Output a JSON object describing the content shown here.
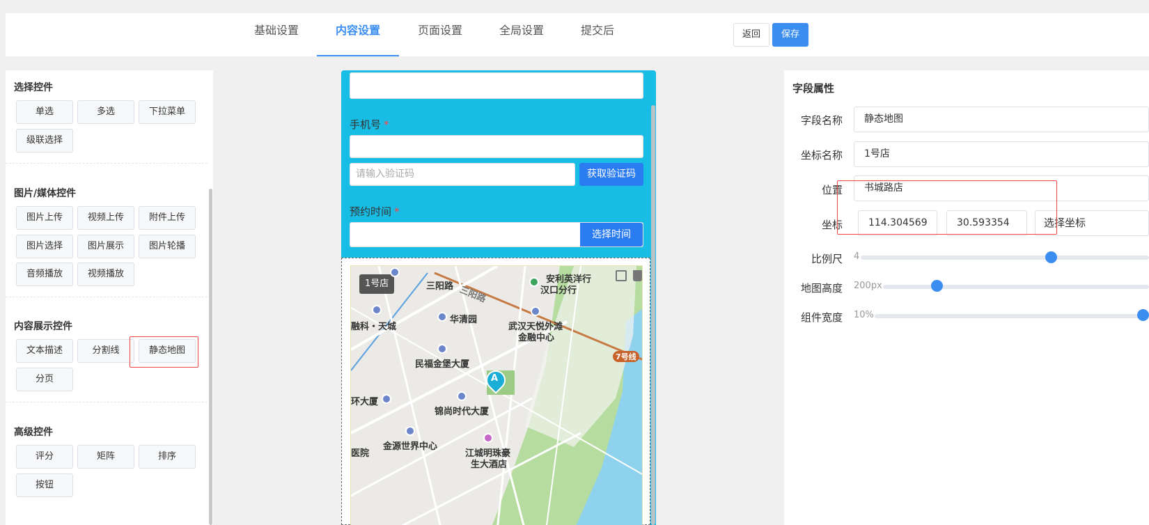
{
  "tabs": [
    "基础设置",
    "内容设置",
    "页面设置",
    "全局设置",
    "提交后"
  ],
  "active_tab": "内容设置",
  "actions": {
    "back": "返回",
    "save": "保存"
  },
  "left": {
    "groups": [
      {
        "title": "选择控件",
        "items": [
          "单选",
          "多选",
          "下拉菜单",
          "级联选择"
        ]
      },
      {
        "title": "图片/媒体控件",
        "items": [
          "图片上传",
          "视频上传",
          "附件上传",
          "图片选择",
          "图片展示",
          "图片轮播",
          "音频播放",
          "视频播放"
        ]
      },
      {
        "title": "内容展示控件",
        "items": [
          "文本描述",
          "分割线",
          "静态地图",
          "分页"
        ]
      },
      {
        "title": "高级控件",
        "items": [
          "评分",
          "矩阵",
          "排序",
          "按钮"
        ]
      }
    ]
  },
  "form": {
    "phone_label": "手机号",
    "required_mark": "*",
    "code_placeholder": "请输入验证码",
    "get_code": "获取验证码",
    "time_label": "预约时间",
    "pick_time": "选择时间"
  },
  "map": {
    "tag": "1号店",
    "labels": [
      "三阳路",
      "三阳路",
      "安利英洋行",
      "汉口分行",
      "融科・天城",
      "华清园",
      "武汉天悦外滩",
      "金融中心",
      "民福金堡大厦",
      "7号线",
      "环大厦",
      "锦尚时代大厦",
      "金源世界中心",
      "江城明珠豪",
      "生大酒店",
      "医院"
    ],
    "marker": "A"
  },
  "props": {
    "title": "字段属性",
    "field_name_label": "字段名称",
    "field_name": "静态地图",
    "coord_name_label": "坐标名称",
    "coord_name": "1号店",
    "location_label": "位置",
    "location": "书城路店",
    "coord_label": "坐标",
    "lng": "114.304569",
    "lat": "30.593354",
    "pick_coord": "选择坐标",
    "scale_label": "比例尺",
    "scale_value": "4",
    "height_label": "地图高度",
    "height_value": "200px",
    "width_label": "组件宽度",
    "width_value": "10%"
  },
  "colors": {
    "accent": "#3b8ef0",
    "phone_bg": "#18bde6",
    "button_blue": "#2a7cf0",
    "highlight": "#ee4444"
  }
}
